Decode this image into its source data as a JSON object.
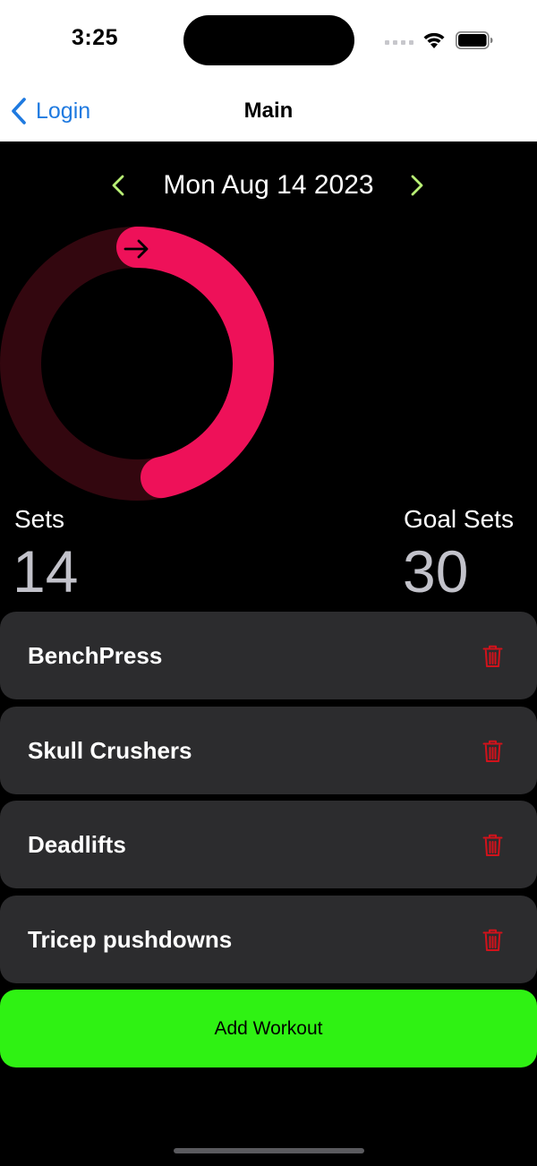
{
  "status_bar": {
    "time": "3:25",
    "icons": [
      "signal-icon",
      "wifi-icon",
      "battery-icon"
    ]
  },
  "nav": {
    "back_label": "Login",
    "title": "Main"
  },
  "date_nav": {
    "date": "Mon Aug 14 2023",
    "prev_icon": "chevron-left-icon",
    "next_icon": "chevron-right-icon"
  },
  "progress_ring": {
    "progress_fraction": 0.4667,
    "icon": "arrow-right-icon"
  },
  "stats": {
    "sets_label": "Sets",
    "sets_value": "14",
    "goal_label": "Goal Sets",
    "goal_value": "30"
  },
  "workouts": [
    {
      "name": "BenchPress"
    },
    {
      "name": "Skull Crushers"
    },
    {
      "name": "Deadlifts"
    },
    {
      "name": "Tricep pushdowns"
    }
  ],
  "add_button": {
    "label": "Add Workout"
  },
  "colors": {
    "accent_blue": "#1f7ae0",
    "chevron_green": "#b8f075",
    "ring_pink": "#ee1159",
    "ring_track": "#33070f",
    "card_bg": "#2c2c2e",
    "trash_red": "#d2121b",
    "add_green": "#2ff213"
  }
}
